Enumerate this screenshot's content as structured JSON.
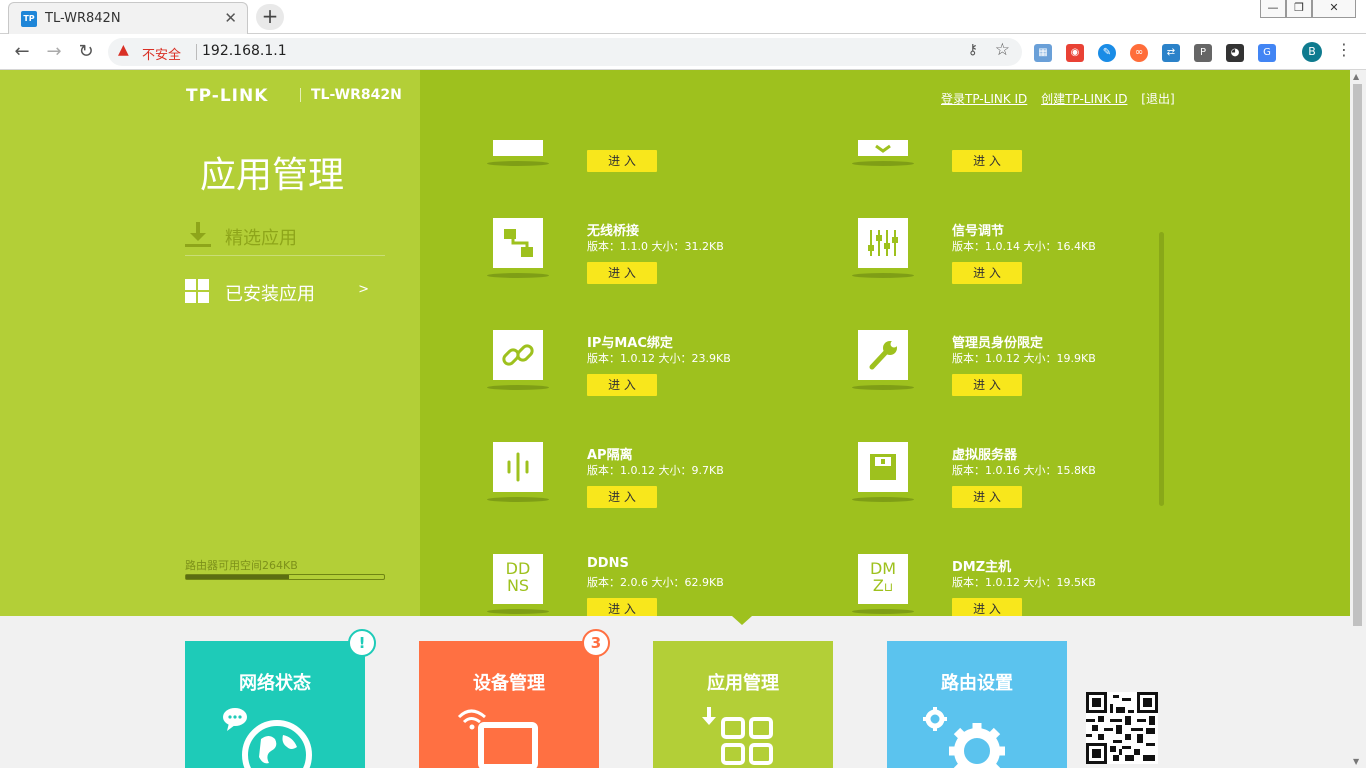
{
  "browser": {
    "tab_title": "TL-WR842N",
    "tab_favicon": "TP",
    "security_label": "不安全",
    "url": "192.168.1.1",
    "profile_initial": "B"
  },
  "header": {
    "brand": "TP-LINK",
    "model": "TL-WR842N",
    "links": [
      "登录TP-LINK ID",
      "创建TP-LINK ID",
      "[退出]"
    ]
  },
  "sidebar": {
    "title": "应用管理",
    "items": [
      {
        "label": "精选应用",
        "icon": "download-icon"
      },
      {
        "label": "已安装应用",
        "icon": "grid-icon",
        "chevron": ">"
      }
    ],
    "storage_label": "路由器可用空间264KB",
    "storage_used_fraction": 0.52
  },
  "apps": {
    "enter_label": "进 入",
    "partial": [
      {
        "icon": "partial-app-icon"
      },
      {
        "icon": "partial-shield-icon"
      }
    ],
    "items": [
      {
        "name": "无线桥接",
        "meta": "版本：1.1.0 大小：31.2KB",
        "icon": "bridge-icon"
      },
      {
        "name": "信号调节",
        "meta": "版本：1.0.14 大小：16.4KB",
        "icon": "sliders-icon"
      },
      {
        "name": "IP与MAC绑定",
        "meta": "版本：1.0.12 大小：23.9KB",
        "icon": "link-icon"
      },
      {
        "name": "管理员身份限定",
        "meta": "版本：1.0.12 大小：19.9KB",
        "icon": "wrench-icon"
      },
      {
        "name": "AP隔离",
        "meta": "版本：1.0.12 大小：9.7KB",
        "icon": "isolation-icon"
      },
      {
        "name": "虚拟服务器",
        "meta": "版本：1.0.16 大小：15.8KB",
        "icon": "server-icon"
      },
      {
        "name": "DDNS",
        "meta": "版本：2.0.6 大小：62.9KB",
        "icon": "ddns-icon",
        "icon_text": [
          "DD",
          "NS"
        ]
      },
      {
        "name": "DMZ主机",
        "meta": "版本：1.0.12 大小：19.5KB",
        "icon": "dmz-icon",
        "icon_text": [
          "DM",
          "Z"
        ]
      }
    ]
  },
  "bottom_nav": [
    {
      "label": "网络状态",
      "color": "#1ecbb8",
      "badge": "!",
      "badge_color": "#1ecbb8"
    },
    {
      "label": "设备管理",
      "color": "#ff7042",
      "badge": "3",
      "badge_color": "#ff7042"
    },
    {
      "label": "应用管理",
      "color": "#b3cf37",
      "active": true
    },
    {
      "label": "路由设置",
      "color": "#5bc3ee"
    }
  ],
  "qr_code": "qr-code-icon"
}
